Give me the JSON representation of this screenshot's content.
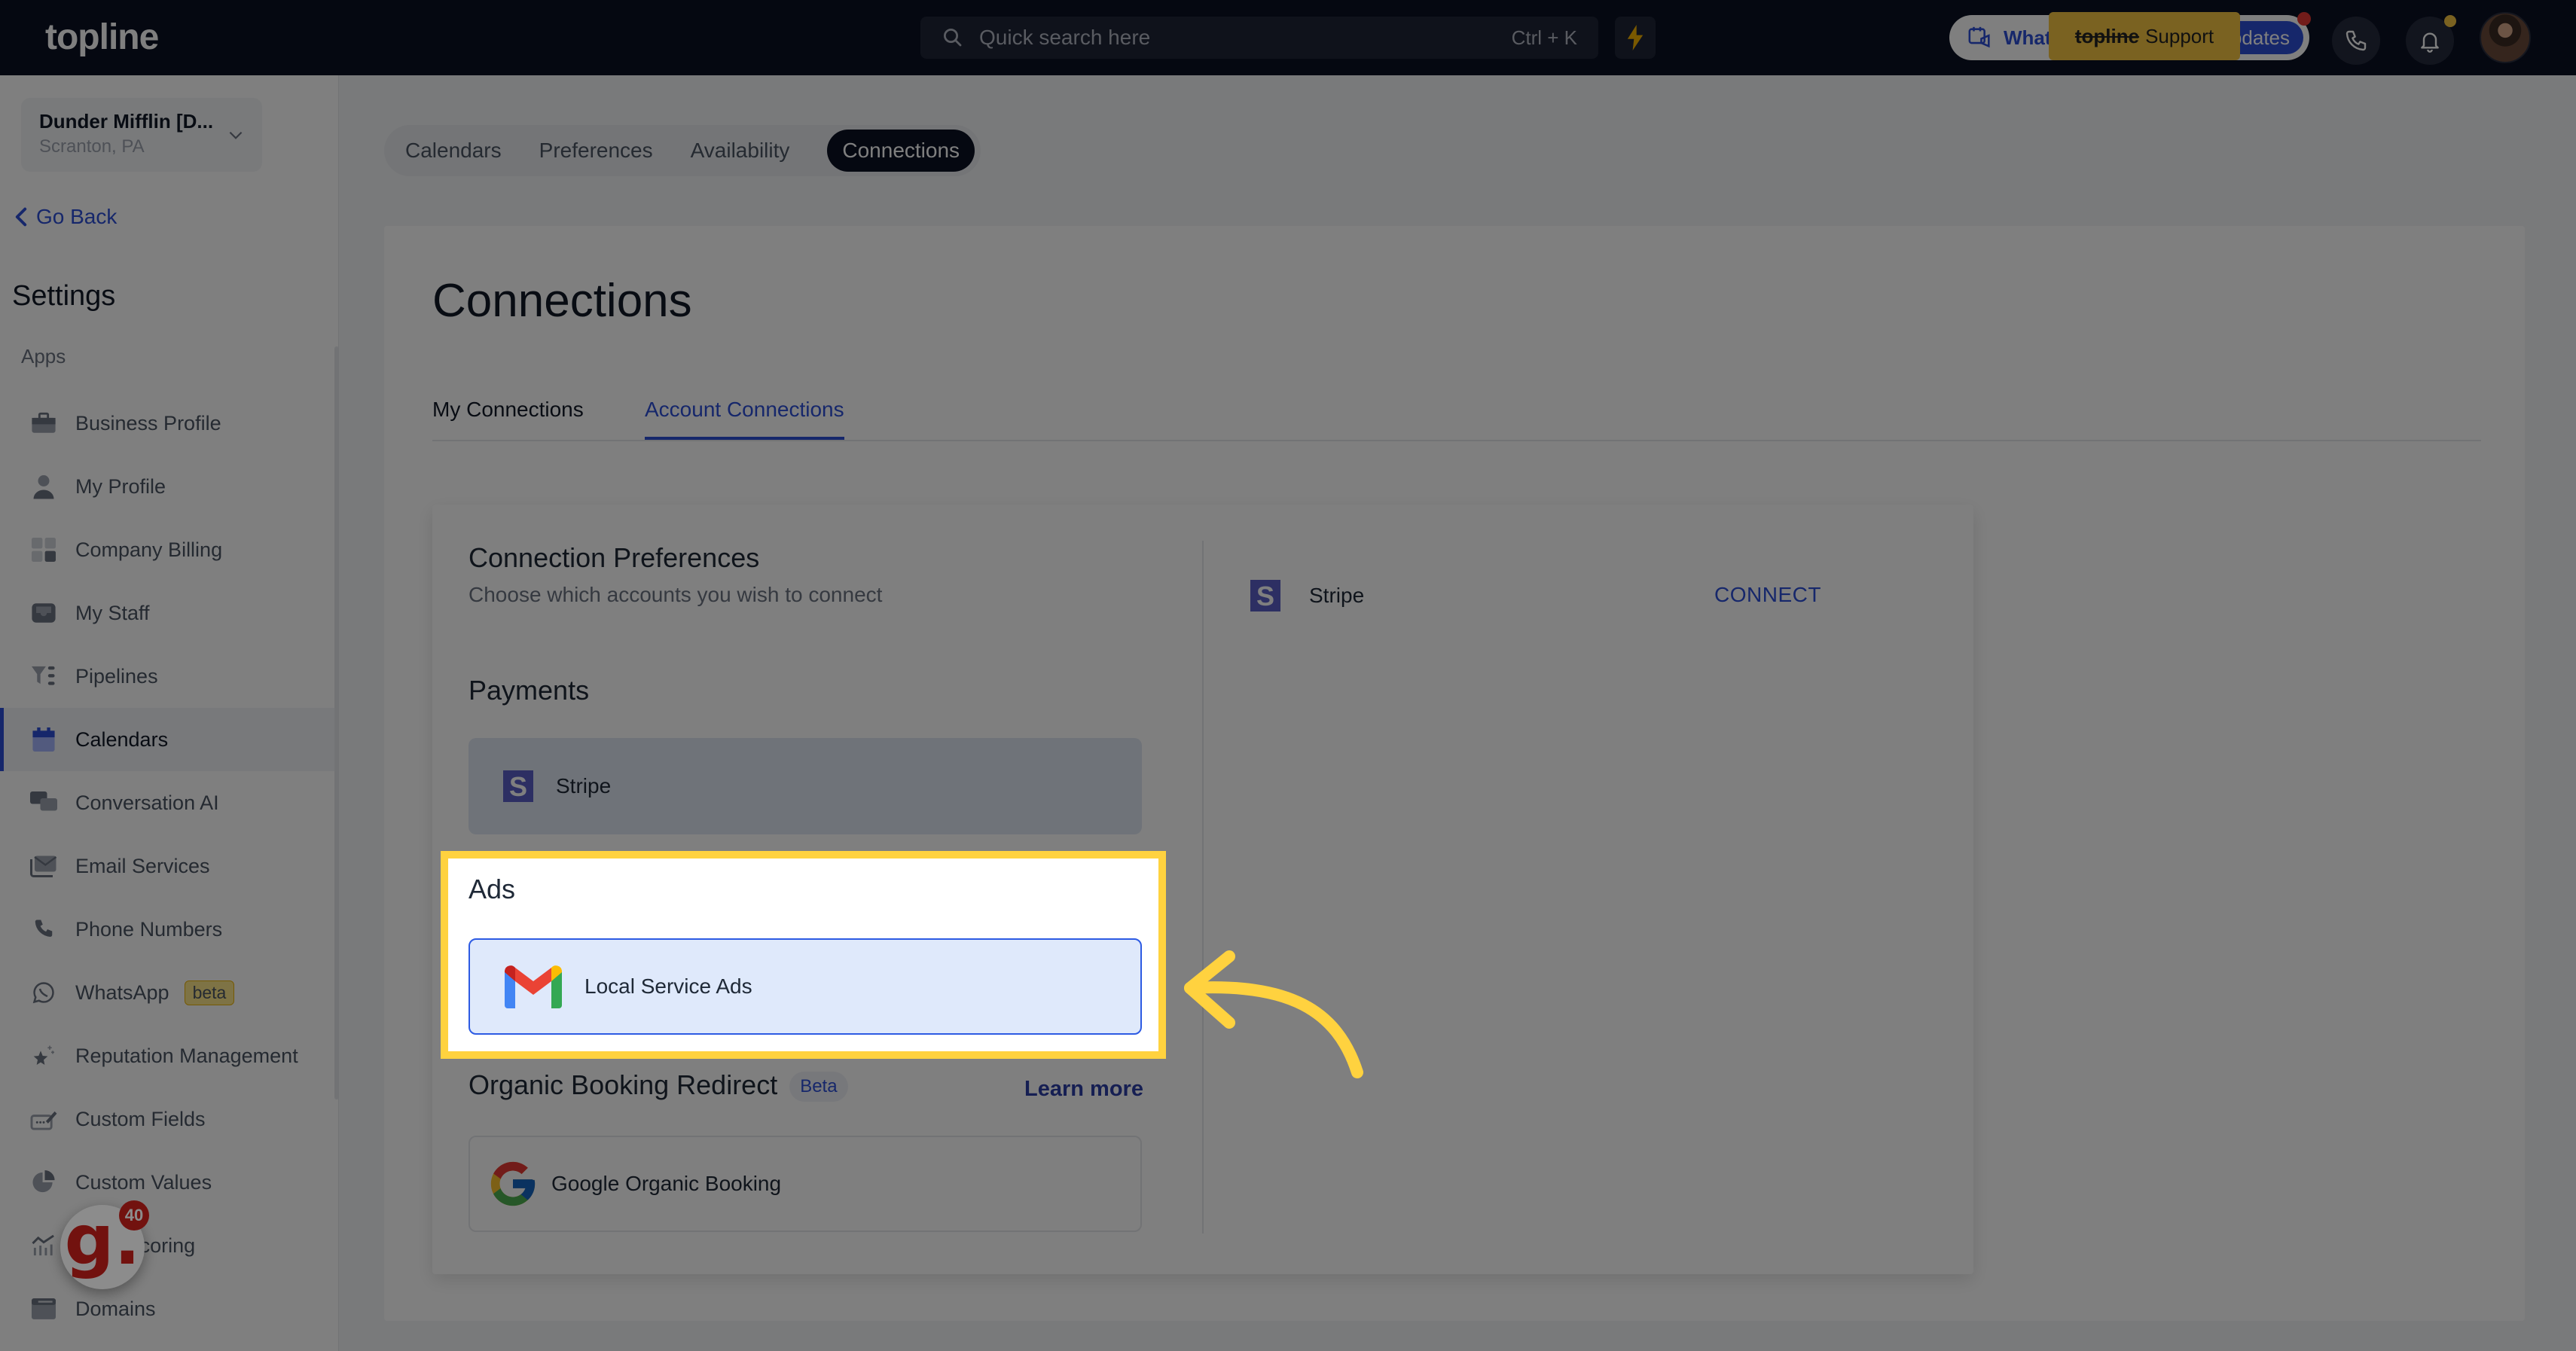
{
  "header": {
    "logo": "topline",
    "search": {
      "placeholder": "Quick search here",
      "shortcut": "Ctrl + K"
    },
    "whats_new": {
      "label": "What's New",
      "updates_label": "Updates"
    },
    "support_tooltip": {
      "brand": "topline",
      "label": "Support"
    },
    "icons": [
      "search-icon",
      "bolt-icon",
      "megaphone-calendar-icon",
      "phone-icon",
      "bell-icon",
      "avatar"
    ]
  },
  "sidebar": {
    "location": {
      "name": "Dunder Mifflin [D...",
      "address": "Scranton, PA"
    },
    "go_back": "Go Back",
    "title": "Settings",
    "section_label": "Apps",
    "items": [
      {
        "label": "Business Profile",
        "icon": "briefcase-icon"
      },
      {
        "label": "My Profile",
        "icon": "user-icon"
      },
      {
        "label": "Company Billing",
        "icon": "calculator-icon"
      },
      {
        "label": "My Staff",
        "icon": "inbox-icon"
      },
      {
        "label": "Pipelines",
        "icon": "filter-list-icon"
      },
      {
        "label": "Calendars",
        "icon": "calendar-icon",
        "active": true
      },
      {
        "label": "Conversation AI",
        "icon": "chat-bubbles-icon"
      },
      {
        "label": "Email Services",
        "icon": "mail-icon"
      },
      {
        "label": "Phone Numbers",
        "icon": "phone-icon"
      },
      {
        "label": "WhatsApp",
        "icon": "whatsapp-icon",
        "badge": "beta"
      },
      {
        "label": "Reputation Management",
        "icon": "star-sparkle-icon"
      },
      {
        "label": "Custom Fields",
        "icon": "edit-field-icon"
      },
      {
        "label": "Custom Values",
        "icon": "pie-chart-icon"
      },
      {
        "label": "Lead Scoring",
        "icon": "chart-bars-icon"
      },
      {
        "label": "Domains",
        "icon": "browser-window-icon"
      }
    ]
  },
  "gist_widget": {
    "letter": "g.",
    "count": "40"
  },
  "main": {
    "subtabs": [
      {
        "label": "Calendars"
      },
      {
        "label": "Preferences"
      },
      {
        "label": "Availability"
      },
      {
        "label": "Connections",
        "active": true
      }
    ],
    "page_title": "Connections",
    "conn_tabs": [
      {
        "label": "My Connections"
      },
      {
        "label": "Account Connections",
        "active": true
      }
    ],
    "preferences": {
      "title": "Connection Preferences",
      "subtitle": "Choose which accounts you wish to connect",
      "sections": {
        "payments": {
          "title": "Payments",
          "provider": "Stripe"
        },
        "ads": {
          "title": "Ads",
          "provider": "Local Service Ads"
        },
        "organic": {
          "title": "Organic Booking Redirect",
          "badge": "Beta",
          "learn_more": "Learn more",
          "provider": "Google Organic Booking"
        }
      }
    },
    "right_panel": {
      "provider": "Stripe",
      "action": "CONNECT"
    }
  },
  "colors": {
    "accent": "#2d4fd6",
    "header_bg": "#0a1022",
    "highlight": "#ffd23f",
    "stripe_brand": "#5b5fc7"
  }
}
